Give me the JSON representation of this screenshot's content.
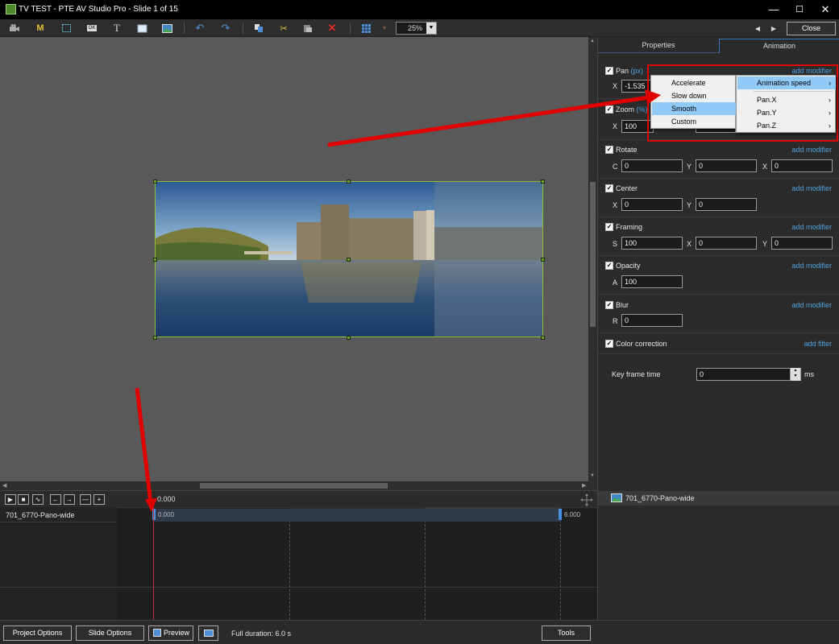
{
  "window": {
    "title": "TV TEST - PTE AV Studio Pro - Slide 1 of 15",
    "minimize": "—",
    "maximize": "☐",
    "close": "✕"
  },
  "toolbar": {
    "items": [
      {
        "name": "camera-icon",
        "glyph": "📷"
      },
      {
        "name": "mask-icon",
        "glyph": "M"
      },
      {
        "name": "frame-icon",
        "glyph": "⬚"
      },
      {
        "name": "ok-icon",
        "glyph": "OK"
      },
      {
        "name": "text-icon",
        "glyph": "T"
      },
      {
        "name": "rectangle-icon",
        "glyph": "▭"
      },
      {
        "name": "image-icon",
        "glyph": "▣"
      },
      {
        "name": "undo-icon",
        "glyph": "↶"
      },
      {
        "name": "redo-icon",
        "glyph": "↷"
      },
      {
        "name": "copy-icon",
        "glyph": "⧉"
      },
      {
        "name": "cut-icon",
        "glyph": "✂"
      },
      {
        "name": "paste-icon",
        "glyph": "📋"
      },
      {
        "name": "delete-icon",
        "glyph": "✕"
      },
      {
        "name": "grid-icon",
        "glyph": "▦"
      }
    ],
    "zoom_value": "25%",
    "prev_glyph": "◀",
    "next_glyph": "▶",
    "close_label": "Close"
  },
  "tabs": {
    "properties": "Properties",
    "animation": "Animation"
  },
  "panel": {
    "pan": {
      "label": "Pan",
      "unit": "(px)",
      "add": "add modifier",
      "x_label": "X",
      "x_value": "-1.535"
    },
    "zoom": {
      "label": "Zoom",
      "unit": "(%)",
      "x_label": "X",
      "x_value": "100"
    },
    "rotate": {
      "label": "Rotate",
      "add": "add modifier",
      "c_label": "C",
      "c_value": "0",
      "y_label": "Y",
      "y_value": "0",
      "x_label": "X",
      "x_value": "0"
    },
    "center": {
      "label": "Center",
      "add": "add modifier",
      "x_label": "X",
      "x_value": "0",
      "y_label": "Y",
      "y_value": "0"
    },
    "framing": {
      "label": "Framing",
      "add": "add modifier",
      "s_label": "S",
      "s_value": "100",
      "x_label": "X",
      "x_value": "0",
      "y_label": "Y",
      "y_value": "0"
    },
    "opacity": {
      "label": "Opacity",
      "add": "add modifier",
      "a_label": "A",
      "a_value": "100"
    },
    "blur": {
      "label": "Blur",
      "add": "add modifier",
      "r_label": "R",
      "r_value": "0"
    },
    "color_correction": {
      "label": "Color correction",
      "add": "add filter"
    },
    "keyframe": {
      "label": "Key frame time",
      "value": "0",
      "unit": "ms"
    }
  },
  "menu_left": {
    "items": [
      "Accelerate",
      "Slow down",
      "Smooth",
      "Custom"
    ],
    "highlighted": "Smooth"
  },
  "menu_right": {
    "items": [
      "Animation speed",
      "Pan.X",
      "Pan.Y",
      "Pan.Z"
    ],
    "highlighted": "Animation speed"
  },
  "timeline": {
    "cursor_time": "0.000",
    "track_name": "701_6770-Pano-wide",
    "start_time": "0.000",
    "end_time": "6.000",
    "right_item": "701_6770-Pano-wide",
    "buttons": [
      "▶",
      "■",
      "∿",
      "←",
      "→",
      "—",
      "+"
    ]
  },
  "status": {
    "project_options": "Project Options",
    "slide_options": "Slide Options",
    "preview": "Preview",
    "duration": "Full duration: 6.0 s",
    "tools": "Tools"
  },
  "colors": {
    "annotation_red": "#e00000",
    "link_blue": "#4fa3e0",
    "selection_green": "#8fbf3a",
    "menu_highlight": "#91c9f7"
  }
}
